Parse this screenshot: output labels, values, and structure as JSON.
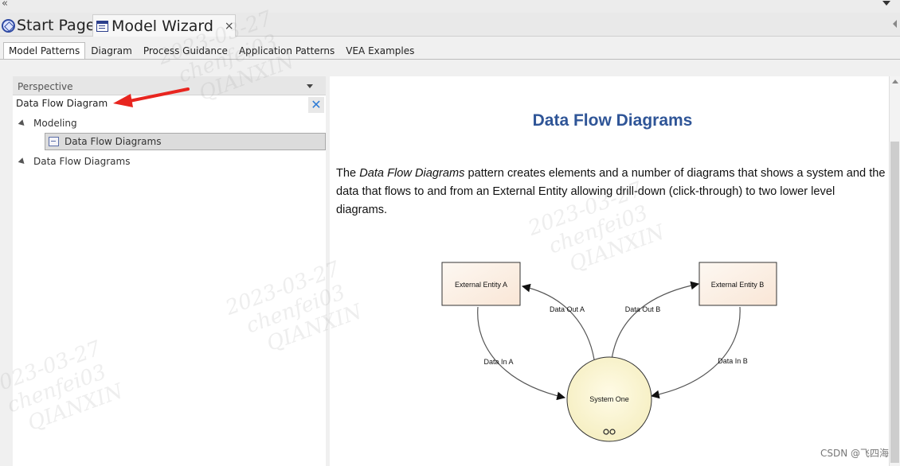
{
  "doc_tabs": [
    {
      "label": "Start Page",
      "icon": "start-page-icon"
    },
    {
      "label": "Model Wizard",
      "icon": "wizard-icon",
      "close": "×"
    }
  ],
  "sub_tabs": [
    "Model Patterns",
    "Diagram",
    "Process Guidance",
    "Application Patterns",
    "VEA Examples"
  ],
  "left": {
    "perspective_label": "Perspective",
    "search_value": "Data Flow Diagram",
    "tree": [
      {
        "label": "Modeling"
      },
      {
        "label": "Data Flow Diagrams",
        "selected": true
      },
      {
        "label": "Data Flow Diagrams"
      }
    ]
  },
  "doc": {
    "title": "Data Flow Diagrams",
    "desc_prefix": "The ",
    "desc_em": "Data Flow Diagrams",
    "desc_rest": " pattern creates elements and a number of diagrams that shows a system and the data that flows to and from an External Entity allowing drill-down (click-through) to two lower level diagrams."
  },
  "diagram": {
    "entity_a": "External Entity A",
    "entity_b": "External Entity B",
    "system": "System One",
    "data_out_a": "Data Out A",
    "data_out_b": "Data Out B",
    "data_in_a": "Data In A",
    "data_in_b": "Data In B"
  },
  "watermark": {
    "date": "2023-03-27",
    "user": "chenfei03",
    "org": "QIANXIN"
  },
  "csdn_text": "CSDN @飞四海"
}
